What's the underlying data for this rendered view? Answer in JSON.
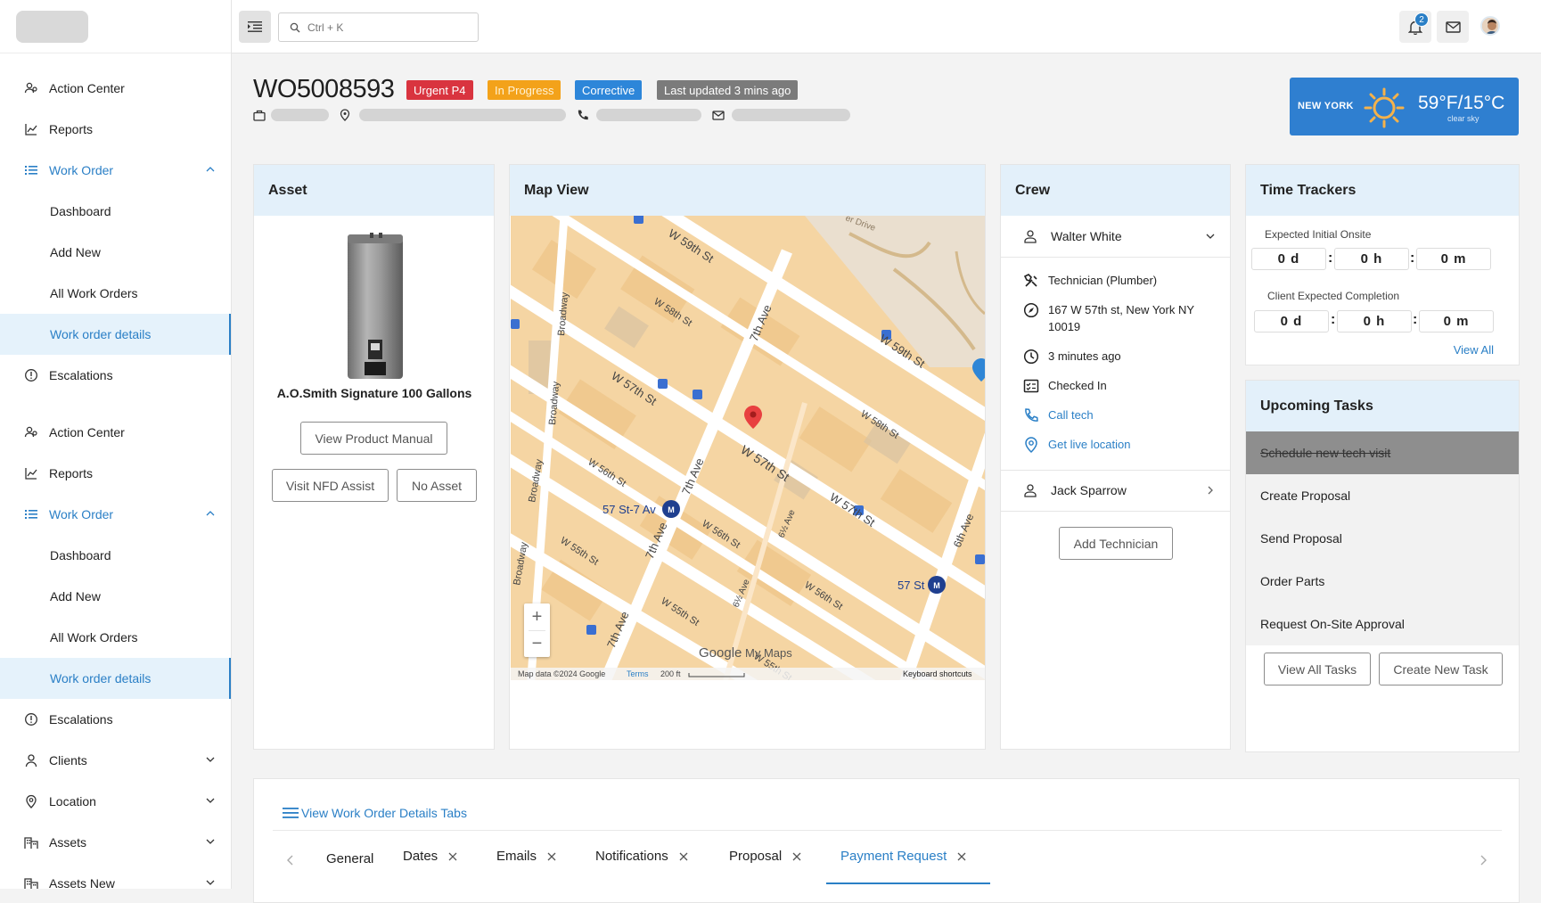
{
  "sidebar": {
    "group1": [
      {
        "label": "Action Center",
        "icon": "people-icon"
      },
      {
        "label": "Reports",
        "icon": "chart-line-icon"
      },
      {
        "label": "Work Order",
        "icon": "list-icon",
        "expanded": true
      },
      {
        "label": "Dashboard"
      },
      {
        "label": "Add New"
      },
      {
        "label": "All Work Orders"
      },
      {
        "label": "Work order details",
        "active": true
      },
      {
        "label": "Escalations",
        "icon": "alert-circle-icon"
      }
    ],
    "group2": [
      {
        "label": "Action Center",
        "icon": "people-icon"
      },
      {
        "label": "Reports",
        "icon": "chart-line-icon"
      },
      {
        "label": "Work Order",
        "icon": "list-icon",
        "expanded": true
      },
      {
        "label": "Dashboard"
      },
      {
        "label": "Add New"
      },
      {
        "label": "All Work Orders"
      },
      {
        "label": "Work order details",
        "active": true
      },
      {
        "label": "Escalations",
        "icon": "alert-circle-icon"
      },
      {
        "label": "Clients",
        "icon": "user-icon"
      },
      {
        "label": "Location",
        "icon": "pin-icon"
      },
      {
        "label": "Assets",
        "icon": "building-icon"
      },
      {
        "label": "Assets New",
        "icon": "building-icon"
      }
    ]
  },
  "topbar": {
    "search_placeholder": "Ctrl + K",
    "notification_count": "2"
  },
  "work_order": {
    "id": "WO5008593",
    "tags": [
      {
        "label": "Urgent P4",
        "bg": "#d9343f",
        "fg": "#ffffff"
      },
      {
        "label": "In Progress",
        "bg": "#f3a21a",
        "fg": "#fff3d6"
      },
      {
        "label": "Corrective",
        "bg": "#2d86d9",
        "fg": "#ffffff"
      },
      {
        "label": "Last updated 3 mins ago",
        "bg": "#7b7b7b",
        "fg": "#ffffff"
      }
    ]
  },
  "weather": {
    "city": "NEW YORK",
    "temp": "59°F/15°C",
    "desc": "clear sky"
  },
  "asset": {
    "title": "Asset",
    "name": "A.O.Smith Signature 100 Gallons",
    "manual_button": "View Product Manual",
    "nfd_button": "Visit NFD Assist",
    "no_asset_button": "No Asset"
  },
  "map": {
    "title": "Map View",
    "streets": [
      "W 59th St",
      "W 58th St",
      "W 57th St",
      "W 56th St",
      "W 55th St",
      "7th Ave",
      "6th Ave",
      "Broadway",
      "6½ Ave",
      "er Drive"
    ],
    "stations": [
      "57 St-7 Av",
      "57 St"
    ],
    "footer_data": "Map data ©2024 Google",
    "footer_terms": "Terms",
    "footer_scale": "200 ft",
    "footer_shortcuts": "Keyboard shortcuts",
    "watermark_google": "Google",
    "watermark_mymaps": "My Maps"
  },
  "crew": {
    "title": "Crew",
    "tech1": "Walter White",
    "role": "Technician (Plumber)",
    "address": "167 W 57th st, New York NY 10019",
    "time": "3 minutes ago",
    "status": "Checked In",
    "call": "Call tech",
    "live": "Get live location",
    "tech2": "Jack Sparrow",
    "add_button": "Add Technician"
  },
  "time_trackers": {
    "title": "Time Trackers",
    "expected_label": "Expected Initial Onsite",
    "expected": [
      "0 d",
      "0 h",
      "0 m"
    ],
    "client_label": "Client Expected Completion",
    "client": [
      "0 d",
      "0 h",
      "0 m"
    ],
    "view_all": "View All"
  },
  "tasks": {
    "title": "Upcoming Tasks",
    "items": [
      {
        "label": "Schedule new tech visit",
        "done": true
      },
      {
        "label": "Create Proposal"
      },
      {
        "label": "Send Proposal"
      },
      {
        "label": "Order Parts"
      },
      {
        "label": "Request On-Site Approval"
      }
    ],
    "view_all": "View All Tasks",
    "create": "Create New Task"
  },
  "details_tabs": {
    "link": "View Work Order Details Tabs",
    "tabs": [
      "General",
      "Dates",
      "Emails",
      "Notifications",
      "Proposal",
      "Payment Request"
    ],
    "active": "Payment Request"
  },
  "colors": {
    "accent": "#2a7fc6",
    "card_header": "#e3f0fa",
    "map_block": "#f6d8a8"
  }
}
